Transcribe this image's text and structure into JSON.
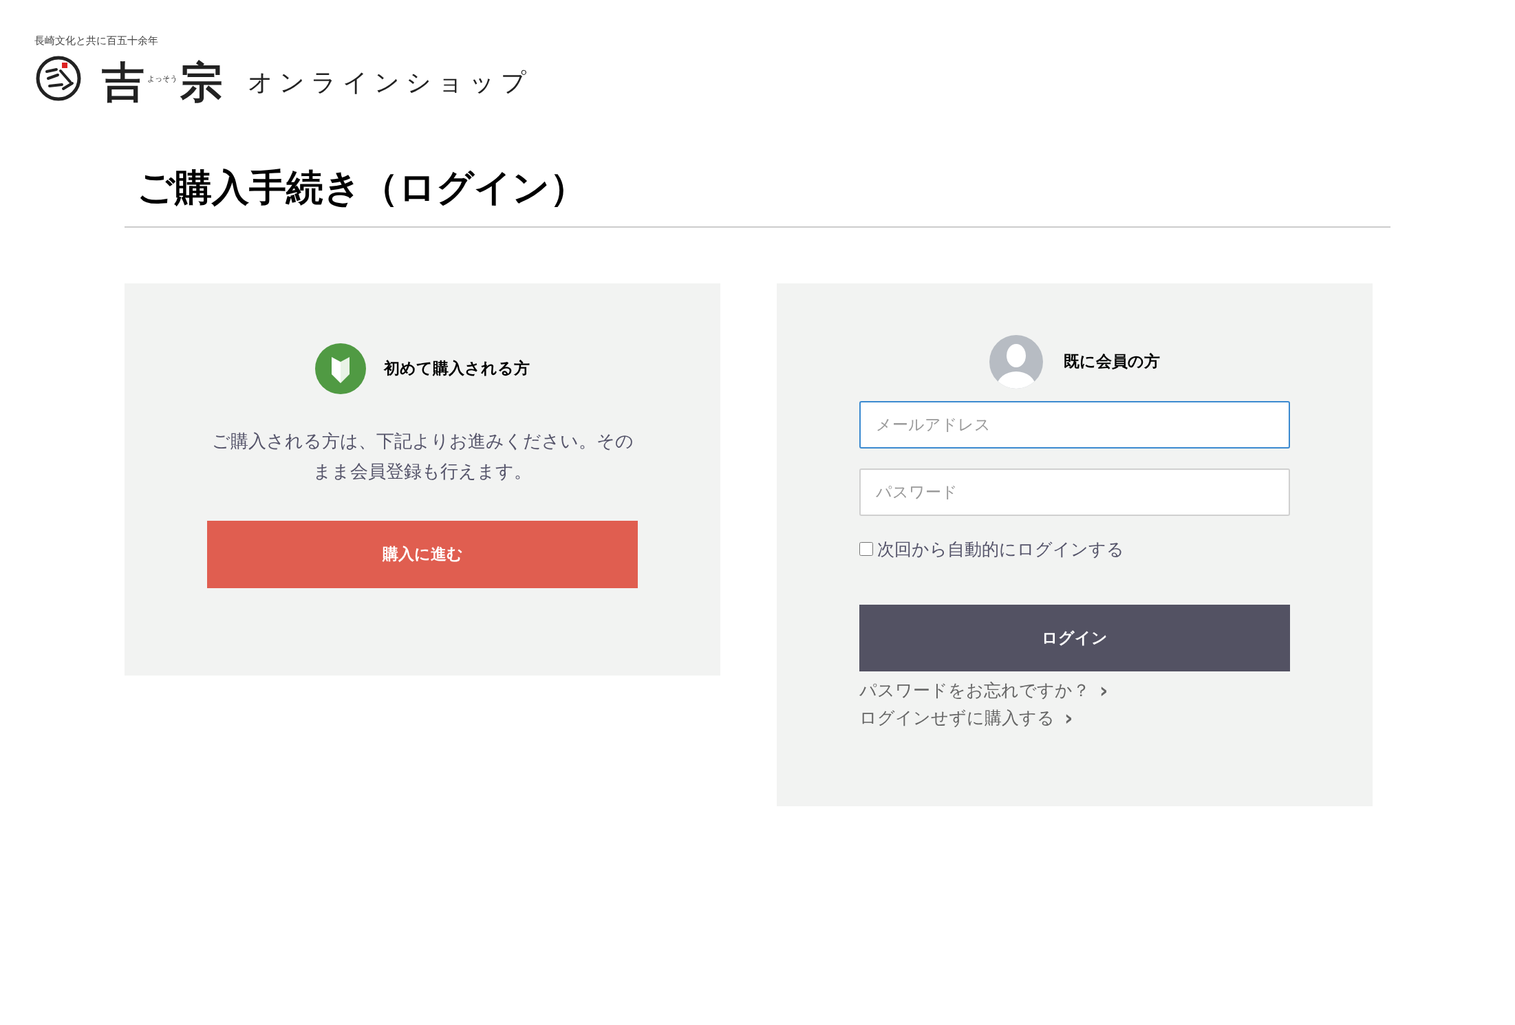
{
  "header": {
    "tagline": "長崎文化と共に百五十余年",
    "brand_chars": [
      "吉",
      "宗"
    ],
    "brand_reading": "よっそう",
    "shop_label": "オンラインショップ"
  },
  "page_title": "ご購入手続き（ログイン）",
  "new_customer": {
    "title": "初めて購入される方",
    "description": "ご購入される方は、下記よりお進みください。そのまま会員登録も行えます。",
    "button": "購入に進む"
  },
  "member": {
    "title": "既に会員の方",
    "fields": [
      {
        "placeholder": "メールアドレス",
        "focused": true
      },
      {
        "placeholder": "パスワード",
        "focused": false
      }
    ],
    "remember": {
      "label": "次回から自動的にログインする",
      "checked": false
    },
    "button": "ログイン",
    "links": [
      {
        "label": "パスワードをお忘れですか？",
        "arrow": "›"
      },
      {
        "label": "ログインせずに購入する",
        "arrow": "›"
      }
    ]
  }
}
